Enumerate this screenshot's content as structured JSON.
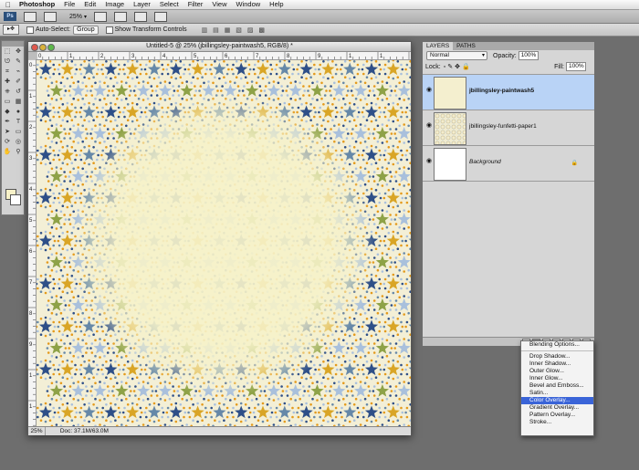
{
  "menubar": {
    "apple_icon": "apple-logo-icon",
    "items": [
      "Photoshop",
      "File",
      "Edit",
      "Image",
      "Layer",
      "Select",
      "Filter",
      "View",
      "Window",
      "Help"
    ]
  },
  "appbar": {
    "ps_logo": "Ps",
    "zoom": "25%"
  },
  "options": {
    "auto_select_label": "Auto-Select:",
    "auto_select_value": "Group",
    "show_transform_label": "Show Transform Controls"
  },
  "document": {
    "title": "Untitled-5 @ 25% (jbillingsley-paintwash5, RGB/8) *",
    "ruler_top": [
      "0",
      "1",
      "2",
      "3",
      "4",
      "5",
      "6",
      "7",
      "8",
      "9",
      "1",
      "1"
    ],
    "ruler_left": [
      "0",
      "1",
      "2",
      "3",
      "4",
      "5",
      "6",
      "7",
      "8",
      "9",
      "1",
      "1"
    ],
    "status_zoom": "25%",
    "status_doc": "Doc: 37.1M/63.0M",
    "pattern_colors": {
      "background": "#f3efd6",
      "center": "#f6f2c9",
      "star_navy": "#2e4f88",
      "star_light": "#a9c0dc",
      "star_gold": "#d9a526",
      "star_green": "#8ea247",
      "star_slate": "#6688a8",
      "dot_orange": "#e49a1c"
    }
  },
  "layers_panel": {
    "tabs": [
      "LAYERS",
      "PATHS"
    ],
    "blend_mode": "Normal",
    "opacity_label": "Opacity:",
    "opacity_value": "100%",
    "lock_label": "Lock:",
    "fill_label": "Fill:",
    "fill_value": "100%",
    "layers": [
      {
        "name": "jbillingsley-paintwash5",
        "selected": true
      },
      {
        "name": "jbillingsley-funfetti-paper1",
        "selected": false
      },
      {
        "name": "Background",
        "selected": false
      }
    ]
  },
  "fx_menu": {
    "items": [
      "Blending Options...",
      "Drop Shadow...",
      "Inner Shadow...",
      "Outer Glow...",
      "Inner Glow...",
      "Bevel and Emboss...",
      "Satin...",
      "Color Overlay...",
      "Gradient Overlay...",
      "Pattern Overlay...",
      "Stroke..."
    ],
    "highlighted": "Color Overlay..."
  }
}
